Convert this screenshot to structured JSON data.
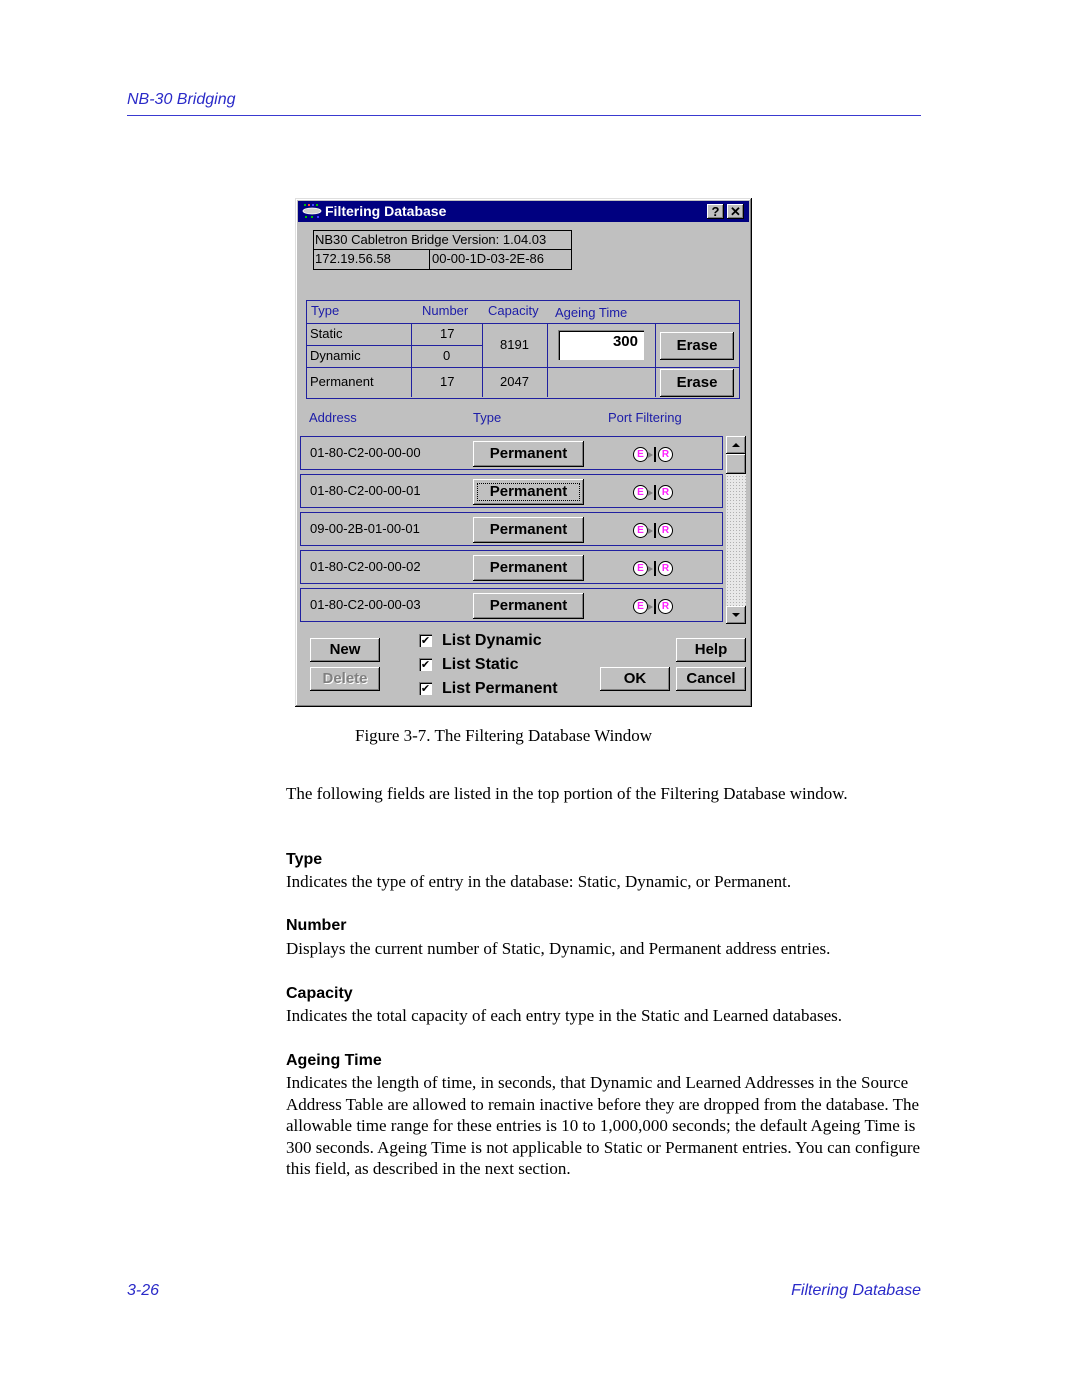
{
  "page": {
    "running_head": "NB-30 Bridging",
    "footer_page": "3-26",
    "footer_section": "Filtering Database"
  },
  "window": {
    "title": "Filtering Database",
    "title_icon": "bridge-app-icon",
    "help_button": "?",
    "close_button": "✕",
    "version_text": "NB30 Cabletron Bridge Version: 1.04.03",
    "ip_address": "172.19.56.58",
    "mac_address": "00-00-1D-03-2E-86",
    "stats": {
      "headers": [
        "Type",
        "Number",
        "Capacity",
        "Ageing Time"
      ],
      "rows": [
        {
          "type": "Static",
          "number": "17"
        },
        {
          "type": "Dynamic",
          "number": "0"
        },
        {
          "type": "Permanent",
          "number": "17"
        }
      ],
      "capacity_learned": "8191",
      "capacity_permanent": "2047",
      "ageing_time_value": "300",
      "erase_label": "Erase"
    },
    "list": {
      "headers": [
        "Address",
        "Type",
        "Port Filtering"
      ],
      "entries": [
        {
          "address": "01-80-C2-00-00-00",
          "type": "Permanent"
        },
        {
          "address": "01-80-C2-00-00-01",
          "type": "Permanent"
        },
        {
          "address": "09-00-2B-01-00-01",
          "type": "Permanent"
        },
        {
          "address": "01-80-C2-00-00-02",
          "type": "Permanent"
        },
        {
          "address": "01-80-C2-00-00-03",
          "type": "Permanent"
        }
      ],
      "port_e": "E",
      "port_r": "R"
    },
    "buttons": {
      "new": "New",
      "delete": "Delete",
      "help": "Help",
      "ok": "OK",
      "cancel": "Cancel"
    },
    "checkboxes": [
      {
        "label": "List Dynamic",
        "checked": true,
        "mark": "✔"
      },
      {
        "label": "List Static",
        "checked": true,
        "mark": "✔"
      },
      {
        "label": "List Permanent",
        "checked": true,
        "mark": "✔"
      }
    ]
  },
  "content": {
    "caption": "Figure 3-7.  The Filtering Database Window",
    "intro": "The following fields are listed in the top portion of the Filtering Database window.",
    "fields": [
      {
        "term": "Type",
        "desc": "Indicates the type of entry in the database: Static, Dynamic, or Permanent."
      },
      {
        "term": "Number",
        "desc": "Displays the current number of Static, Dynamic, and Permanent address entries."
      },
      {
        "term": "Capacity",
        "desc": "Indicates the total capacity of each entry type in the Static and Learned databases."
      },
      {
        "term": "Ageing Time",
        "desc": "Indicates the length of time, in seconds, that Dynamic and Learned Addresses in the Source Address Table are allowed to remain inactive before they are dropped from the database. The allowable time range for these entries is 10 to 1,000,000 seconds; the default Ageing Time is 300 seconds. Ageing Time is not applicable to Static or Permanent entries. You can configure this field, as described in the next section."
      }
    ]
  }
}
